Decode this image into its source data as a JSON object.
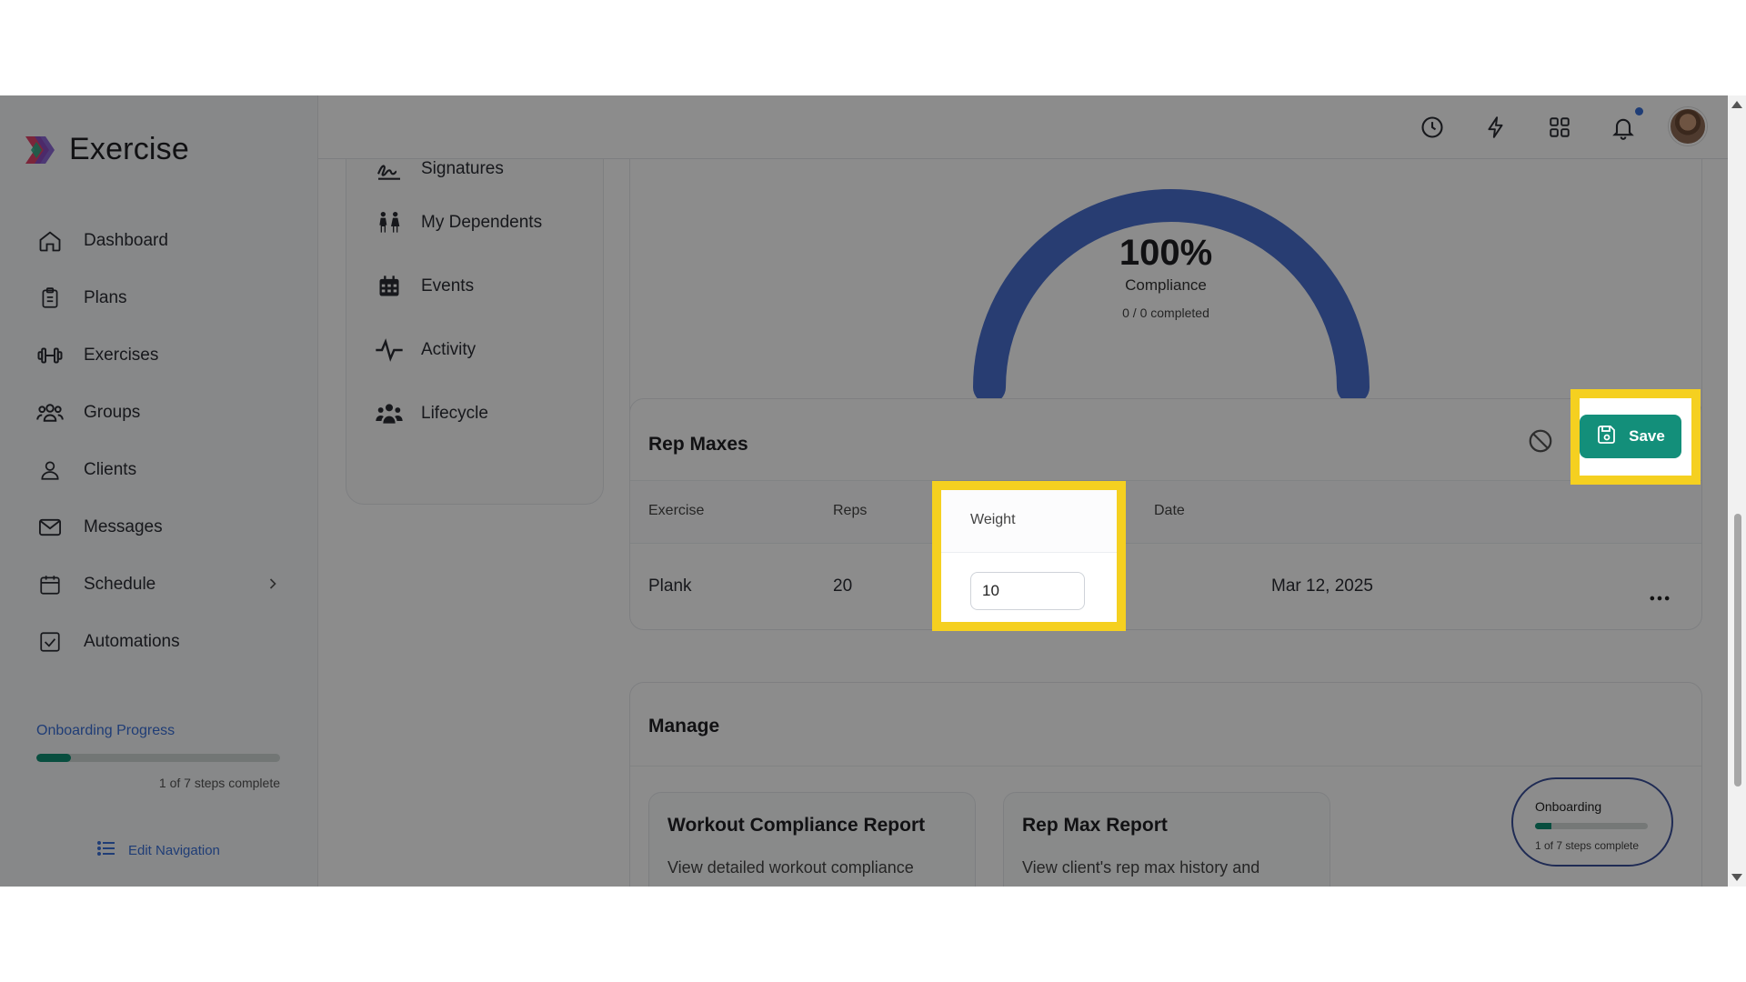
{
  "app": {
    "name": "Exercise"
  },
  "sidebar": {
    "items": [
      {
        "label": "Dashboard",
        "icon": "home-icon"
      },
      {
        "label": "Plans",
        "icon": "clipboard-icon"
      },
      {
        "label": "Exercises",
        "icon": "dumbbell-icon"
      },
      {
        "label": "Groups",
        "icon": "users-icon"
      },
      {
        "label": "Clients",
        "icon": "user-icon"
      },
      {
        "label": "Messages",
        "icon": "mail-icon"
      },
      {
        "label": "Schedule",
        "icon": "calendar-icon"
      },
      {
        "label": "Automations",
        "icon": "checkbox-icon"
      }
    ],
    "onboarding": {
      "label": "Onboarding Progress",
      "steps_text": "1 of 7 steps complete",
      "progress": 0.143
    },
    "edit_nav": "Edit Navigation"
  },
  "submenu": {
    "items": [
      {
        "label": "Signatures",
        "icon": "signature-icon"
      },
      {
        "label": "My Dependents",
        "icon": "family-icon"
      },
      {
        "label": "Events",
        "icon": "calendar-grid-icon"
      },
      {
        "label": "Activity",
        "icon": "activity-icon"
      },
      {
        "label": "Lifecycle",
        "icon": "people-group-icon"
      }
    ]
  },
  "compliance": {
    "percent": "100%",
    "label": "Compliance",
    "completed": "0 / 0 completed",
    "value": 1.0
  },
  "rep_maxes": {
    "title": "Rep Maxes",
    "save_label": "Save",
    "columns": [
      "Exercise",
      "Reps",
      "Weight",
      "Date"
    ],
    "rows": [
      {
        "exercise": "Plank",
        "reps": "20",
        "weight": "10",
        "date": "Mar 12, 2025"
      }
    ]
  },
  "manage": {
    "title": "Manage",
    "reports": [
      {
        "title": "Workout Compliance Report",
        "desc": "View detailed workout compliance statistics"
      },
      {
        "title": "Rep Max Report",
        "desc": "View client's rep max history and"
      }
    ]
  },
  "onboarding_pill": {
    "title": "Onboarding",
    "steps": "1 of 7 steps complete",
    "progress": 0.143
  },
  "colors": {
    "accent": "#138f7a",
    "link": "#3a6fd8",
    "gauge": "#4a6fd0",
    "highlight": "#f5d020"
  }
}
